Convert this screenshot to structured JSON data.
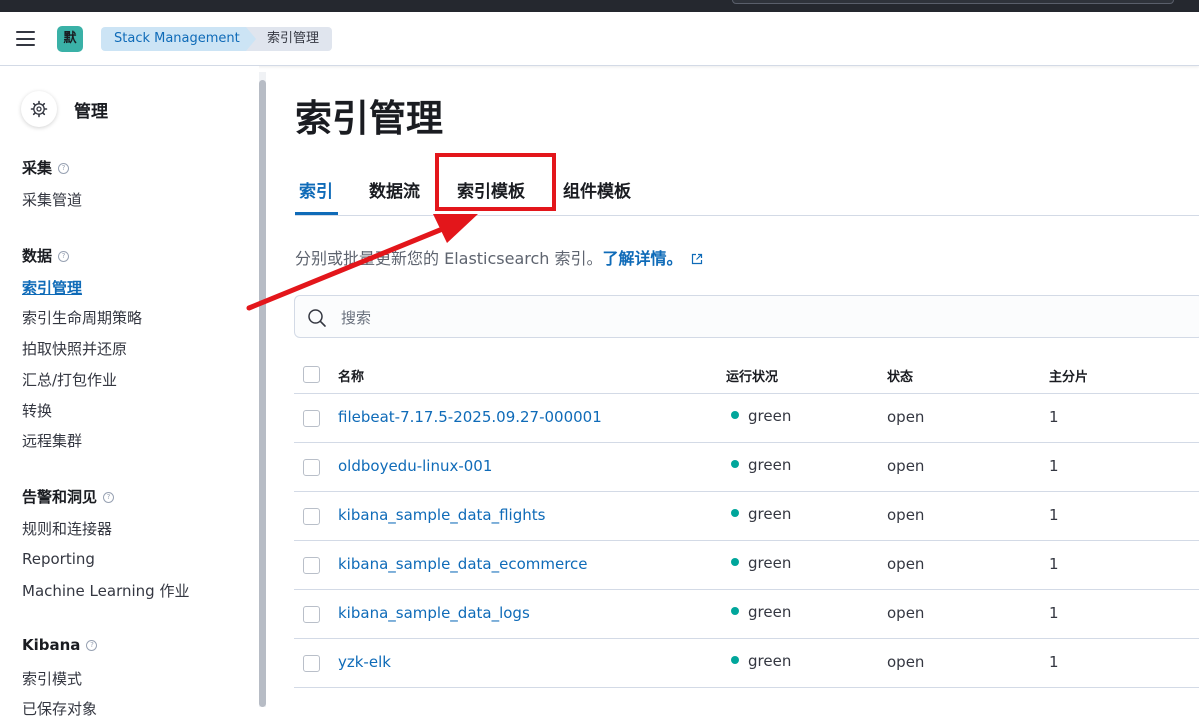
{
  "header": {
    "space_badge": "默",
    "breadcrumbs": [
      "Stack Management",
      "索引管理"
    ]
  },
  "sidebar": {
    "title": "管理",
    "groups": [
      {
        "label": "采集",
        "items": [
          "采集管道"
        ]
      },
      {
        "label": "数据",
        "items": [
          "索引管理",
          "索引生命周期策略",
          "拍取快照并还原",
          "汇总/打包作业",
          "转换",
          "远程集群"
        ]
      },
      {
        "label": "告警和洞见",
        "items": [
          "规则和连接器",
          "Reporting",
          "Machine Learning 作业"
        ]
      },
      {
        "label": "Kibana",
        "items": [
          "索引模式",
          "已保存对象"
        ]
      }
    ],
    "active_item": "索引管理"
  },
  "main": {
    "title": "索引管理",
    "tabs": [
      "索引",
      "数据流",
      "索引模板",
      "组件模板"
    ],
    "active_tab": "索引",
    "highlighted_tab": "索引模板",
    "description": "分别或批量更新您的 Elasticsearch 索引。",
    "learn_more": "了解详情。",
    "search_placeholder": "搜索",
    "table": {
      "columns": [
        "名称",
        "运行状况",
        "状态",
        "主分片"
      ],
      "rows": [
        {
          "name": "filebeat-7.17.5-2025.09.27-000001",
          "health": "green",
          "status": "open",
          "primary": "1"
        },
        {
          "name": "oldboyedu-linux-001",
          "health": "green",
          "status": "open",
          "primary": "1"
        },
        {
          "name": "kibana_sample_data_flights",
          "health": "green",
          "status": "open",
          "primary": "1"
        },
        {
          "name": "kibana_sample_data_ecommerce",
          "health": "green",
          "status": "open",
          "primary": "1"
        },
        {
          "name": "kibana_sample_data_logs",
          "health": "green",
          "status": "open",
          "primary": "1"
        },
        {
          "name": "yzk-elk",
          "health": "green",
          "status": "open",
          "primary": "1"
        }
      ]
    }
  },
  "colors": {
    "accent": "#0f6bb8",
    "health_green": "#00a69b",
    "annotation_red": "#e3161b",
    "space_badge": "#3ab1a7"
  },
  "icons": [
    "menu-icon",
    "gear-icon",
    "help-icon",
    "external-link-icon",
    "search-icon"
  ]
}
